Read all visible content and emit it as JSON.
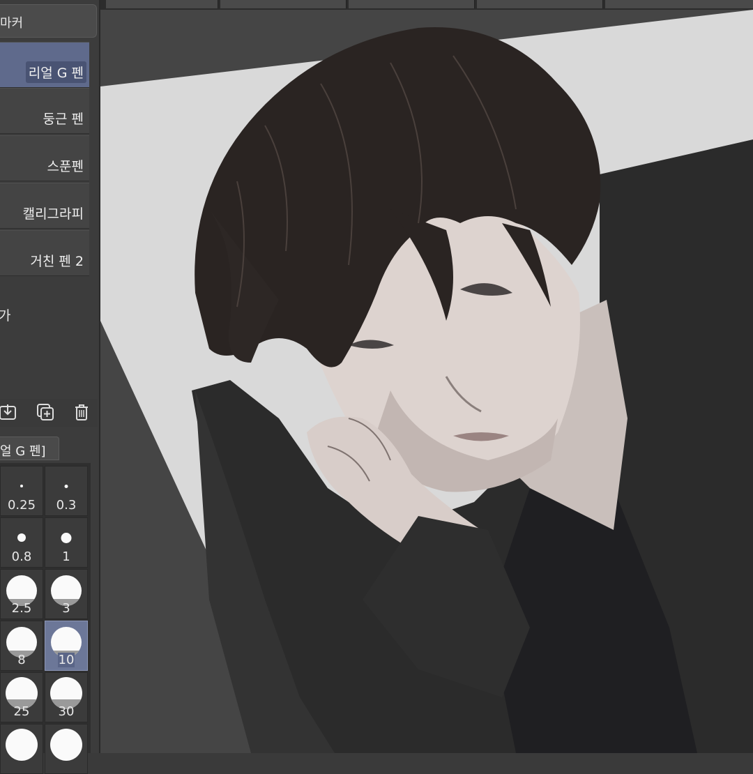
{
  "panel": {
    "header_label": "마커",
    "brushes": [
      {
        "label": "리얼 G 펜",
        "selected": true
      },
      {
        "label": "둥근 펜",
        "selected": false
      },
      {
        "label": "스푼펜",
        "selected": false
      },
      {
        "label": "캘리그라피",
        "selected": false
      },
      {
        "label": "거친 펜 2",
        "selected": false
      }
    ],
    "extra_label": "가",
    "tools": [
      "import-icon",
      "duplicate-icon",
      "trash-icon"
    ]
  },
  "brush_size": {
    "header_label": "얼 G 펜]",
    "sizes": [
      "0.25",
      "0.3",
      "0.8",
      "1",
      "2.5",
      "3",
      "8",
      "10",
      "25",
      "30"
    ],
    "selected": "10"
  },
  "colors": {
    "panel_bg": "#3c3c3c",
    "selection": "#5f6a8c",
    "canvas_paper": "#d8d8d8"
  }
}
